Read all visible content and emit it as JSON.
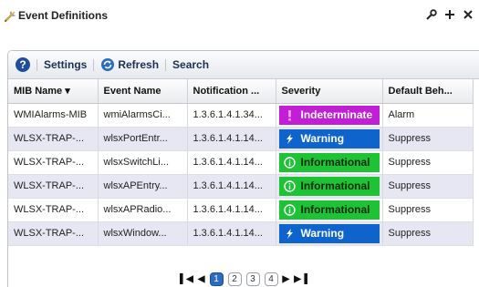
{
  "window": {
    "title": "Event Definitions"
  },
  "toolbar": {
    "settings_label": "Settings",
    "refresh_label": "Refresh",
    "search_label": "Search"
  },
  "table": {
    "columns": [
      "MIB Name ▾",
      "Event Name",
      "Notification ...",
      "Severity",
      "Default Beh..."
    ],
    "rows": [
      {
        "mib": "WMIAlarms-MIB",
        "event": "wmiAlarmsCi...",
        "oid": "1.3.6.1.4.1.34...",
        "severity": "Indeterminate",
        "severity_class": "indeterminate",
        "behavior": "Alarm"
      },
      {
        "mib": "WLSX-TRAP-...",
        "event": "wlsxPortEntr...",
        "oid": "1.3.6.1.4.1.14...",
        "severity": "Warning",
        "severity_class": "warning",
        "behavior": "Suppress"
      },
      {
        "mib": "WLSX-TRAP-...",
        "event": "wlsxSwitchLi...",
        "oid": "1.3.6.1.4.1.14...",
        "severity": "Informational",
        "severity_class": "informational",
        "behavior": "Suppress"
      },
      {
        "mib": "WLSX-TRAP-...",
        "event": "wlsxAPEntry...",
        "oid": "1.3.6.1.4.1.14...",
        "severity": "Informational",
        "severity_class": "informational",
        "behavior": "Suppress"
      },
      {
        "mib": "WLSX-TRAP-...",
        "event": "wlsxAPRadio...",
        "oid": "1.3.6.1.4.1.14...",
        "severity": "Informational",
        "severity_class": "informational",
        "behavior": "Suppress"
      },
      {
        "mib": "WLSX-TRAP-...",
        "event": "wlsxWindow...",
        "oid": "1.3.6.1.4.1.14...",
        "severity": "Warning",
        "severity_class": "warning",
        "behavior": "Suppress"
      }
    ]
  },
  "pager": {
    "pages": [
      "1",
      "2",
      "3",
      "4"
    ],
    "current": "1"
  },
  "colors": {
    "indeterminate": "#c21ed6",
    "warning": "#0f64cc",
    "informational": "#1ec335",
    "alt_row": "#e6e7f3"
  },
  "icons": {
    "app": "wrench-icon",
    "help": "help-icon",
    "refresh": "refresh-icon"
  }
}
